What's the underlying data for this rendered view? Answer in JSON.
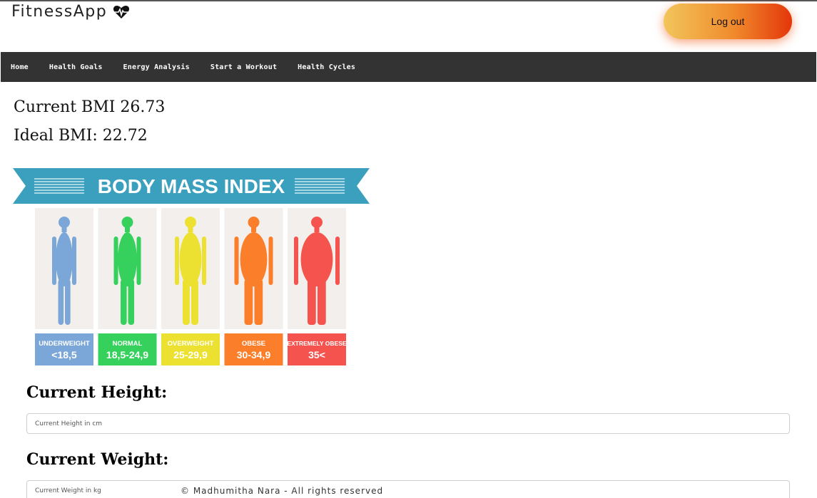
{
  "header": {
    "brand": "FitnessApp",
    "brand_icon": "heartbeat-icon",
    "logout_label": "Log out"
  },
  "nav": {
    "items": [
      {
        "label": "Home"
      },
      {
        "label": "Health Goals"
      },
      {
        "label": "Energy Analysis"
      },
      {
        "label": "Start a Workout"
      },
      {
        "label": "Health Cycles"
      }
    ]
  },
  "bmi": {
    "current_label": "Current BMI 26.73",
    "ideal_label": "Ideal BMI: 22.72"
  },
  "bmi_chart": {
    "banner": "BODY MASS INDEX",
    "categories": [
      {
        "name": "UNDERWEIGHT",
        "range": "<18,5",
        "color": "#7aa7d8"
      },
      {
        "name": "NORMAL",
        "range": "18,5-24,9",
        "color": "#35d15c"
      },
      {
        "name": "OVERWEIGHT",
        "range": "25-29,9",
        "color": "#ece131"
      },
      {
        "name": "OBESE",
        "range": "30-34,9",
        "color": "#fb7e2a"
      },
      {
        "name": "EXTREMELY OBESE",
        "range": "35<",
        "color": "#f5534e"
      }
    ],
    "banner_color": "#3aa0bd"
  },
  "form": {
    "height_title": "Current Height:",
    "height_placeholder": "Current Height in cm",
    "weight_title": "Current Weight:",
    "weight_placeholder": "Current Weight in kg"
  },
  "footer": {
    "text": "© Madhumitha Nara - All rights reserved"
  }
}
